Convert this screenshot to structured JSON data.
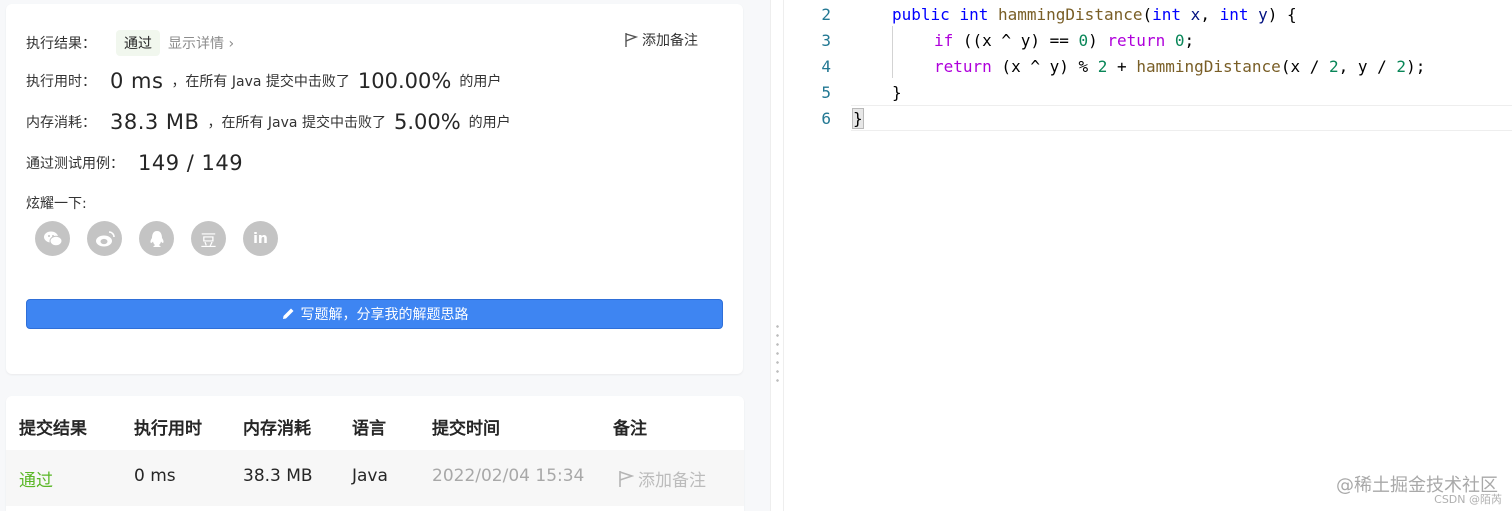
{
  "result": {
    "label": "执行结果：",
    "status": "通过",
    "detail_link": "显示详情 ›",
    "note_button": "添加备注",
    "runtime": {
      "label": "执行用时：",
      "value": "0 ms",
      "mid": "，在所有 Java 提交中击败了",
      "percent": "100.00%",
      "suffix": "的用户"
    },
    "memory": {
      "label": "内存消耗：",
      "value": "38.3 MB",
      "mid": "，在所有 Java 提交中击败了",
      "percent": "5.00%",
      "suffix": "的用户"
    },
    "tests": {
      "label": "通过测试用例：",
      "value": "149 / 149"
    },
    "share": {
      "label": "炫耀一下:",
      "icons": [
        "wechat-icon",
        "weibo-icon",
        "qq-icon",
        "douban-icon",
        "linkedin-icon"
      ],
      "douban_glyph": "豆",
      "linkedin_glyph": "in"
    },
    "write_button": "写题解，分享我的解题思路"
  },
  "table": {
    "headers": [
      "提交结果",
      "执行用时",
      "内存消耗",
      "语言",
      "提交时间",
      "备注"
    ],
    "rows": [
      {
        "result": "通过",
        "runtime": "0 ms",
        "memory": "38.3 MB",
        "language": "Java",
        "time": "2022/02/04 15:34",
        "note": "添加备注"
      }
    ]
  },
  "editor": {
    "line_numbers": [
      "2",
      "3",
      "4",
      "5",
      "6"
    ],
    "line2": {
      "kw1": "public",
      "kw2": "int",
      "fn": "hammingDistance",
      "p1": "(",
      "t1": "int",
      "v1": "x",
      "c": ", ",
      "t2": "int",
      "v2": "y",
      "p2": ") {"
    },
    "line3": {
      "kw": "if",
      "a": " ((x ^ y) == ",
      "n": "0",
      "b": ") ",
      "ret": "return",
      "c": " ",
      "n2": "0",
      "d": ";"
    },
    "line4": {
      "ret": "return",
      "a": " (x ^ y) % ",
      "n1": "2",
      "b": " + ",
      "fn": "hammingDistance",
      "c": "(x / ",
      "n2": "2",
      "d": ", y / ",
      "n3": "2",
      "e": ");"
    },
    "line5": "}",
    "line6": "}"
  },
  "watermark": "@稀土掘金技术社区",
  "watermark_small": "CSDN @陌芮",
  "colors": {
    "accent_blue": "#3e85f2",
    "pass_green": "#5ab726"
  }
}
